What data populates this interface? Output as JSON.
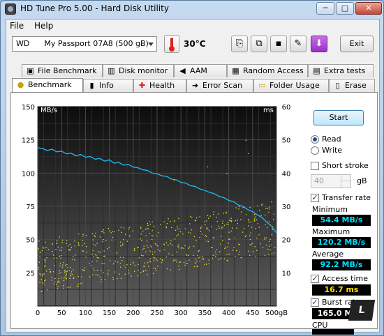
{
  "window": {
    "title": "HD Tune Pro 5.00 - Hard Disk Utility",
    "minimize": "─",
    "maximize": "□",
    "close": "✕"
  },
  "menu": [
    {
      "label": "File"
    },
    {
      "label": "Help"
    }
  ],
  "toolbar": {
    "drive_selected": "WD      My Passport 07A8 (500 gB)",
    "temperature": "30°C",
    "exit_label": "Exit",
    "tool_icons": [
      "copy-info-icon",
      "copy-screenshot-icon",
      "save-icon",
      "options-icon",
      "download-icon"
    ]
  },
  "tabs_top": [
    {
      "label": "File Benchmark",
      "icon": "file-benchmark-icon",
      "glyph": "▣"
    },
    {
      "label": "Disk monitor",
      "icon": "disk-monitor-icon",
      "glyph": "▥"
    },
    {
      "label": "AAM",
      "icon": "speaker-icon",
      "glyph": "◀"
    },
    {
      "label": "Random Access",
      "icon": "random-access-icon",
      "glyph": "▦"
    },
    {
      "label": "Extra tests",
      "icon": "extra-tests-icon",
      "glyph": "▤"
    }
  ],
  "tabs_bottom": [
    {
      "label": "Benchmark",
      "icon": "benchmark-icon",
      "glyph": "●",
      "active": true
    },
    {
      "label": "Info",
      "icon": "info-icon",
      "glyph": "▮"
    },
    {
      "label": "Health",
      "icon": "health-cross-icon",
      "glyph": "✚"
    },
    {
      "label": "Error Scan",
      "icon": "error-scan-icon",
      "glyph": "➜"
    },
    {
      "label": "Folder Usage",
      "icon": "folder-icon",
      "glyph": "▭"
    },
    {
      "label": "Erase",
      "icon": "trash-icon",
      "glyph": "▯"
    }
  ],
  "panel": {
    "start_label": "Start",
    "read_label": "Read",
    "write_label": "Write",
    "short_stroke_label": "Short stroke",
    "short_stroke_value": "40",
    "short_stroke_unit": "gB",
    "transfer_rate_label": "Transfer rate",
    "minimum_label": "Minimum",
    "minimum_value": "54.4 MB/s",
    "maximum_label": "Maximum",
    "maximum_value": "120.2 MB/s",
    "average_label": "Average",
    "average_value": "92.2 MB/s",
    "access_time_label": "Access time",
    "access_time_value": "16.7 ms",
    "burst_rate_label": "Burst rate",
    "burst_rate_value": "165.0 MB/s",
    "cpu_label": "CPU",
    "logo_text": "L"
  },
  "colors": {
    "transfer_line": "#1fb4e8",
    "access_points": "#e6e63c",
    "plot_bg": "#111111",
    "grid": "#4a4a4a"
  },
  "chart_data": {
    "type": "line",
    "x_unit": "gB",
    "y_left_unit": "MB/s",
    "y_right_unit": "ms",
    "x_ticks": [
      "0",
      "50",
      "100",
      "150",
      "200",
      "250",
      "300",
      "350",
      "400",
      "450",
      "500gB"
    ],
    "y_left_ticks": [
      "150",
      "125",
      "100",
      "75",
      "50",
      "25"
    ],
    "y_right_ticks": [
      "60",
      "50",
      "40",
      "30",
      "20",
      "10"
    ],
    "xlim": [
      0,
      500
    ],
    "ylim_left": [
      0,
      150
    ],
    "ylim_right": [
      0,
      60
    ],
    "series": [
      {
        "type": "line",
        "axis": "left",
        "x": [
          0,
          10,
          20,
          30,
          40,
          50,
          60,
          70,
          80,
          90,
          100,
          110,
          120,
          130,
          140,
          150,
          160,
          170,
          180,
          190,
          200,
          210,
          220,
          230,
          240,
          250,
          260,
          270,
          280,
          290,
          300,
          310,
          320,
          330,
          340,
          350,
          360,
          370,
          380,
          390,
          400,
          410,
          420,
          430,
          440,
          450,
          460,
          470,
          480,
          490,
          500
        ],
        "values": [
          119,
          118.5,
          117,
          118,
          116,
          116.5,
          114.5,
          115,
          113,
          114,
          112,
          112.5,
          110.5,
          111,
          109,
          110,
          107.5,
          108,
          106,
          106.5,
          104.5,
          104,
          102.5,
          102,
          100,
          99.5,
          98,
          97.5,
          95.5,
          95,
          93,
          92.5,
          90.5,
          90,
          88,
          87,
          85.5,
          84.5,
          82.5,
          81.5,
          79.5,
          78.5,
          76,
          75,
          72.5,
          71,
          68.5,
          66.5,
          63,
          60,
          55
        ]
      },
      {
        "type": "scatter",
        "axis": "right",
        "x_range": [
          0,
          500
        ],
        "values_range": [
          2,
          32
        ],
        "count": 600,
        "mean_trend_ms": [
          12,
          24
        ]
      }
    ]
  }
}
